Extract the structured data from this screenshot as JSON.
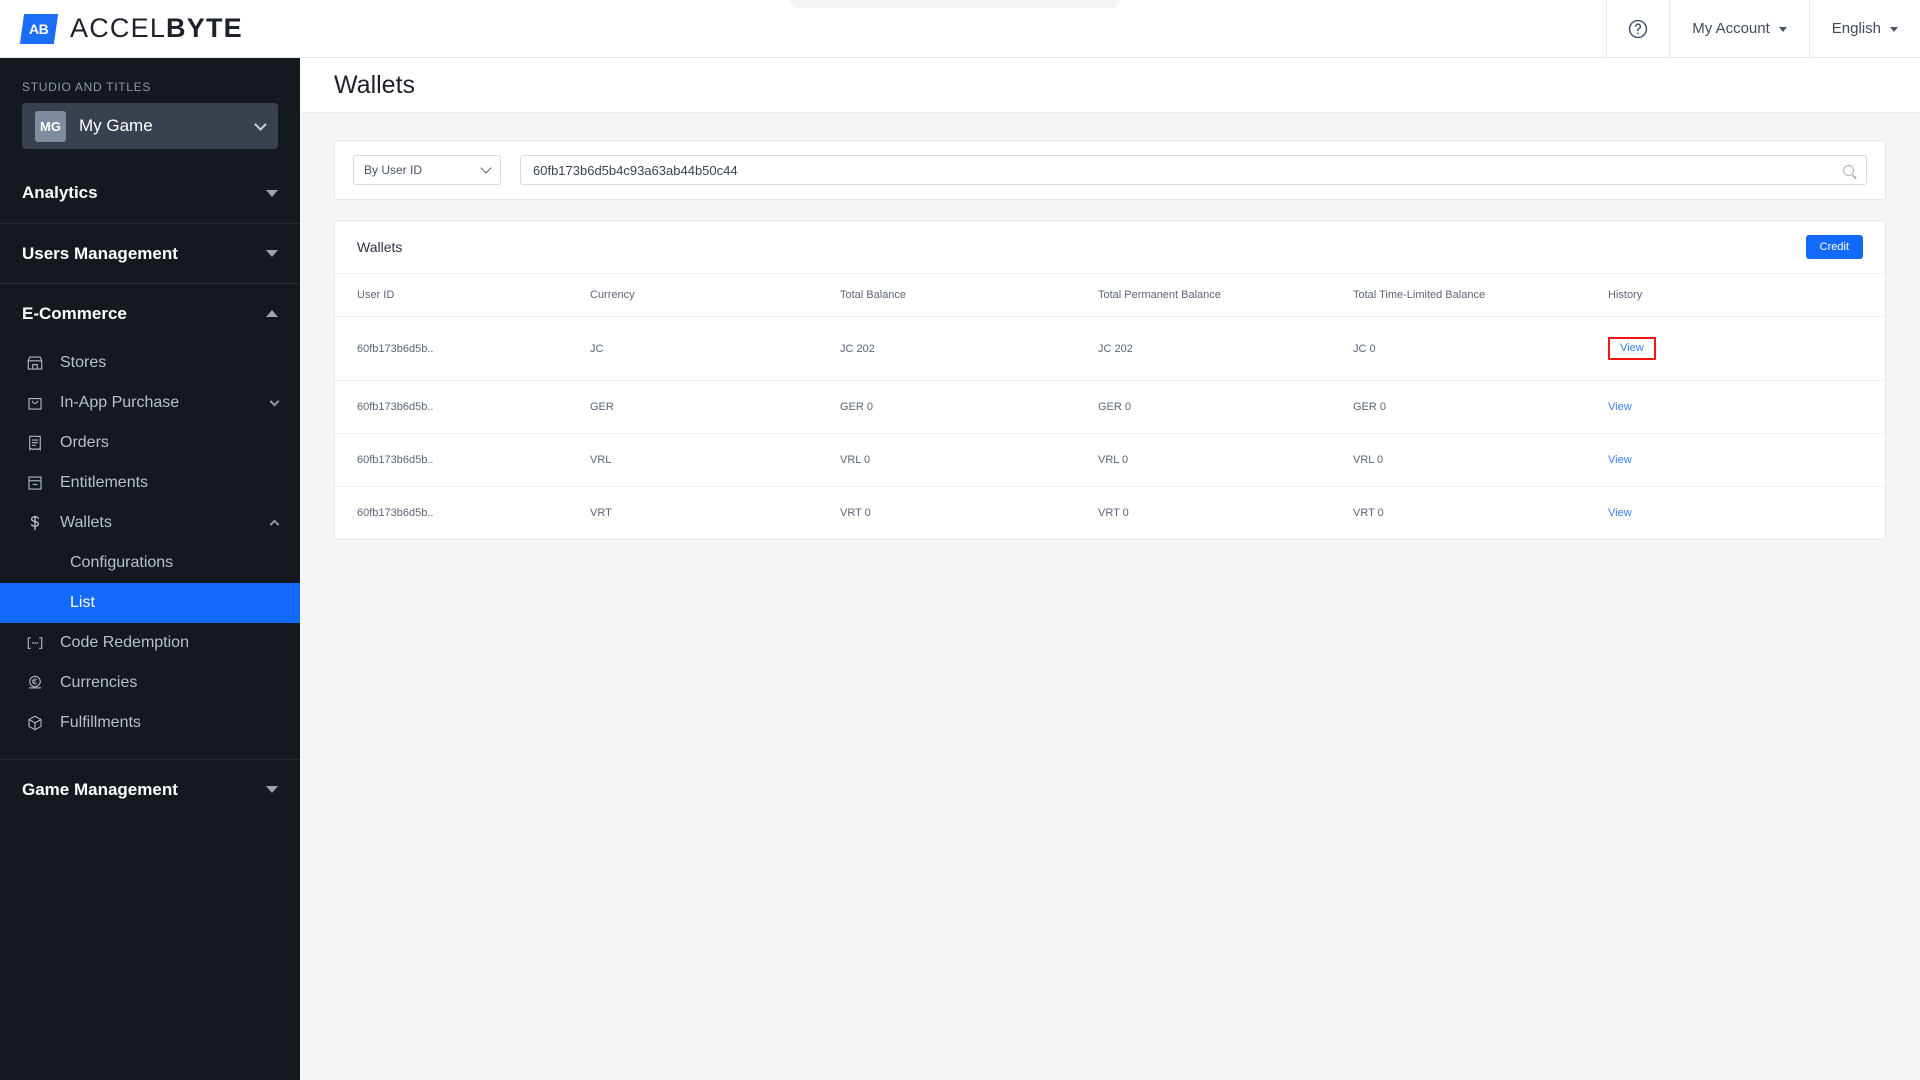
{
  "brand": {
    "mark_text": "AB",
    "name_light": "ACCEL",
    "name_bold": "BYTE",
    "accent_color": "#1b6cf6"
  },
  "topbar": {
    "help_icon": "help-circle-icon",
    "account_label": "My Account",
    "language_label": "English"
  },
  "sidebar": {
    "studio_label": "STUDIO AND TITLES",
    "title_badge": "MG",
    "title_name": "My Game",
    "groups": [
      {
        "label": "Analytics",
        "state": "collapsed"
      },
      {
        "label": "Users Management",
        "state": "collapsed"
      },
      {
        "label": "E-Commerce",
        "state": "expanded"
      },
      {
        "label": "Game Management",
        "state": "collapsed"
      }
    ],
    "ecommerce_items": [
      {
        "label": "Stores",
        "icon": "store-icon",
        "expandable": false
      },
      {
        "label": "In-App Purchase",
        "icon": "shopping-bag-icon",
        "expandable": true
      },
      {
        "label": "Orders",
        "icon": "receipt-icon",
        "expandable": false
      },
      {
        "label": "Entitlements",
        "icon": "archive-box-icon",
        "expandable": false
      },
      {
        "label": "Wallets",
        "icon": "dollar-sign-icon",
        "expandable": true,
        "expanded": true
      }
    ],
    "wallet_subitems": [
      {
        "label": "Configurations",
        "active": false
      },
      {
        "label": "List",
        "active": true
      }
    ],
    "ecommerce_items_bottom": [
      {
        "label": "Code Redemption",
        "icon": "code-brackets-icon"
      },
      {
        "label": "Currencies",
        "icon": "coin-euro-icon"
      },
      {
        "label": "Fulfillments",
        "icon": "package-icon"
      }
    ],
    "active_color": "#1269fb"
  },
  "page": {
    "title": "Wallets"
  },
  "search": {
    "filter_selected": "By User ID",
    "filter_options": [
      "By User ID"
    ],
    "query_value": "60fb173b6d5b4c93a63ab44b50c44",
    "search_icon": "search-icon"
  },
  "table": {
    "card_title": "Wallets",
    "credit_button": "Credit",
    "columns": [
      "User ID",
      "Currency",
      "Total Balance",
      "Total Permanent Balance",
      "Total Time-Limited Balance",
      "History"
    ],
    "rows": [
      {
        "user_id": "60fb173b6d5b..",
        "currency": "JC",
        "total_balance": "JC 202",
        "total_permanent_balance": "JC 202",
        "total_time_limited_balance": "JC 0",
        "history": "View",
        "highlighted": true
      },
      {
        "user_id": "60fb173b6d5b..",
        "currency": "GER",
        "total_balance": "GER 0",
        "total_permanent_balance": "GER 0",
        "total_time_limited_balance": "GER 0",
        "history": "View",
        "highlighted": false
      },
      {
        "user_id": "60fb173b6d5b..",
        "currency": "VRL",
        "total_balance": "VRL 0",
        "total_permanent_balance": "VRL 0",
        "total_time_limited_balance": "VRL 0",
        "history": "View",
        "highlighted": false
      },
      {
        "user_id": "60fb173b6d5b..",
        "currency": "VRT",
        "total_balance": "VRT 0",
        "total_permanent_balance": "VRT 0",
        "total_time_limited_balance": "VRT 0",
        "history": "View",
        "highlighted": false
      }
    ],
    "highlight_color": "#f41414",
    "link_color": "#3b7ef5"
  }
}
